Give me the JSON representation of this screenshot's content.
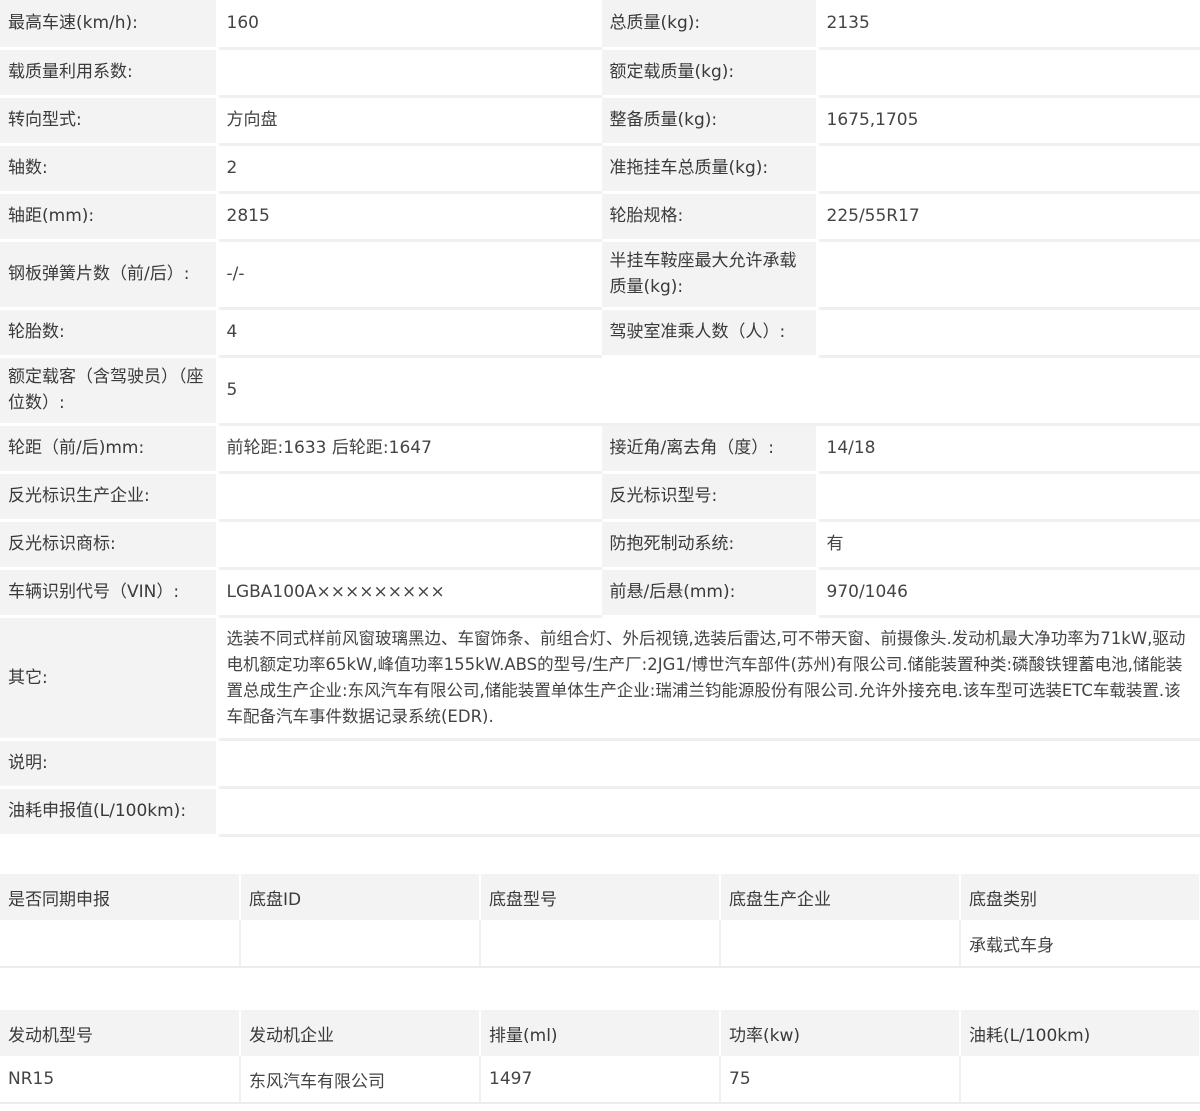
{
  "specs": {
    "max_speed_label": "最高车速(km/h):",
    "max_speed": "160",
    "total_mass_label": "总质量(kg):",
    "total_mass": "2135",
    "load_util_label": "载质量利用系数:",
    "load_util": "",
    "rated_load_label": "额定载质量(kg):",
    "rated_load": "",
    "steering_label": "转向型式:",
    "steering": "方向盘",
    "curb_mass_label": "整备质量(kg):",
    "curb_mass": "1675,1705",
    "axles_label": "轴数:",
    "axles": "2",
    "trailer_mass_label": "准拖挂车总质量(kg):",
    "trailer_mass": "",
    "wheelbase_label": "轴距(mm):",
    "wheelbase": "2815",
    "tire_spec_label": "轮胎规格:",
    "tire_spec": "225/55R17",
    "leaf_spring_label": "钢板弹簧片数（前/后）:",
    "leaf_spring": "-/-",
    "saddle_mass_label": "半挂车鞍座最大允许承载质量(kg):",
    "saddle_mass": "",
    "tire_count_label": "轮胎数:",
    "tire_count": "4",
    "cab_seats_label": "驾驶室准乘人数（人）:",
    "cab_seats": "",
    "passengers_label": "额定载客（含驾驶员）（座位数）:",
    "passengers": "5",
    "track_label": "轮距（前/后)mm:",
    "track": "前轮距:1633 后轮距:1647",
    "angle_label": "接近角/离去角（度）:",
    "angle": "14/18",
    "reflector_maker_label": "反光标识生产企业:",
    "reflector_maker": "",
    "reflector_model_label": "反光标识型号:",
    "reflector_model": "",
    "reflector_brand_label": "反光标识商标:",
    "reflector_brand": "",
    "abs_label": "防抱死制动系统:",
    "abs": "有",
    "vin_label": "车辆识别代号（VIN）:",
    "vin": "LGBA100A×××××××××",
    "overhang_label": "前悬/后悬(mm):",
    "overhang": "970/1046",
    "other_label": "其它:",
    "other": "选装不同式样前风窗玻璃黑边、车窗饰条、前组合灯、外后视镜,选装后雷达,可不带天窗、前摄像头.发动机最大净功率为71kW,驱动电机额定功率65kW,峰值功率155kW.ABS的型号/生产厂:2JG1/博世汽车部件(苏州)有限公司.储能装置种类:磷酸铁锂蓄电池,储能装置总成生产企业:东风汽车有限公司,储能装置单体生产企业:瑞浦兰钧能源股份有限公司.允许外接充电.该车型可选装ETC车载装置.该车配备汽车事件数据记录系统(EDR).",
    "note_label": "说明:",
    "note": "",
    "fuel_label": "油耗申报值(L/100km):",
    "fuel": ""
  },
  "chassis": {
    "headers": [
      "是否同期申报",
      "底盘ID",
      "底盘型号",
      "底盘生产企业",
      "底盘类别"
    ],
    "values": [
      "",
      "",
      "",
      "",
      "承载式车身"
    ]
  },
  "engine": {
    "headers": [
      "发动机型号",
      "发动机企业",
      "排量(ml)",
      "功率(kw)",
      "油耗(L/100km)"
    ],
    "values": [
      "NR15",
      "东风汽车有限公司",
      "1497",
      "75",
      ""
    ]
  }
}
